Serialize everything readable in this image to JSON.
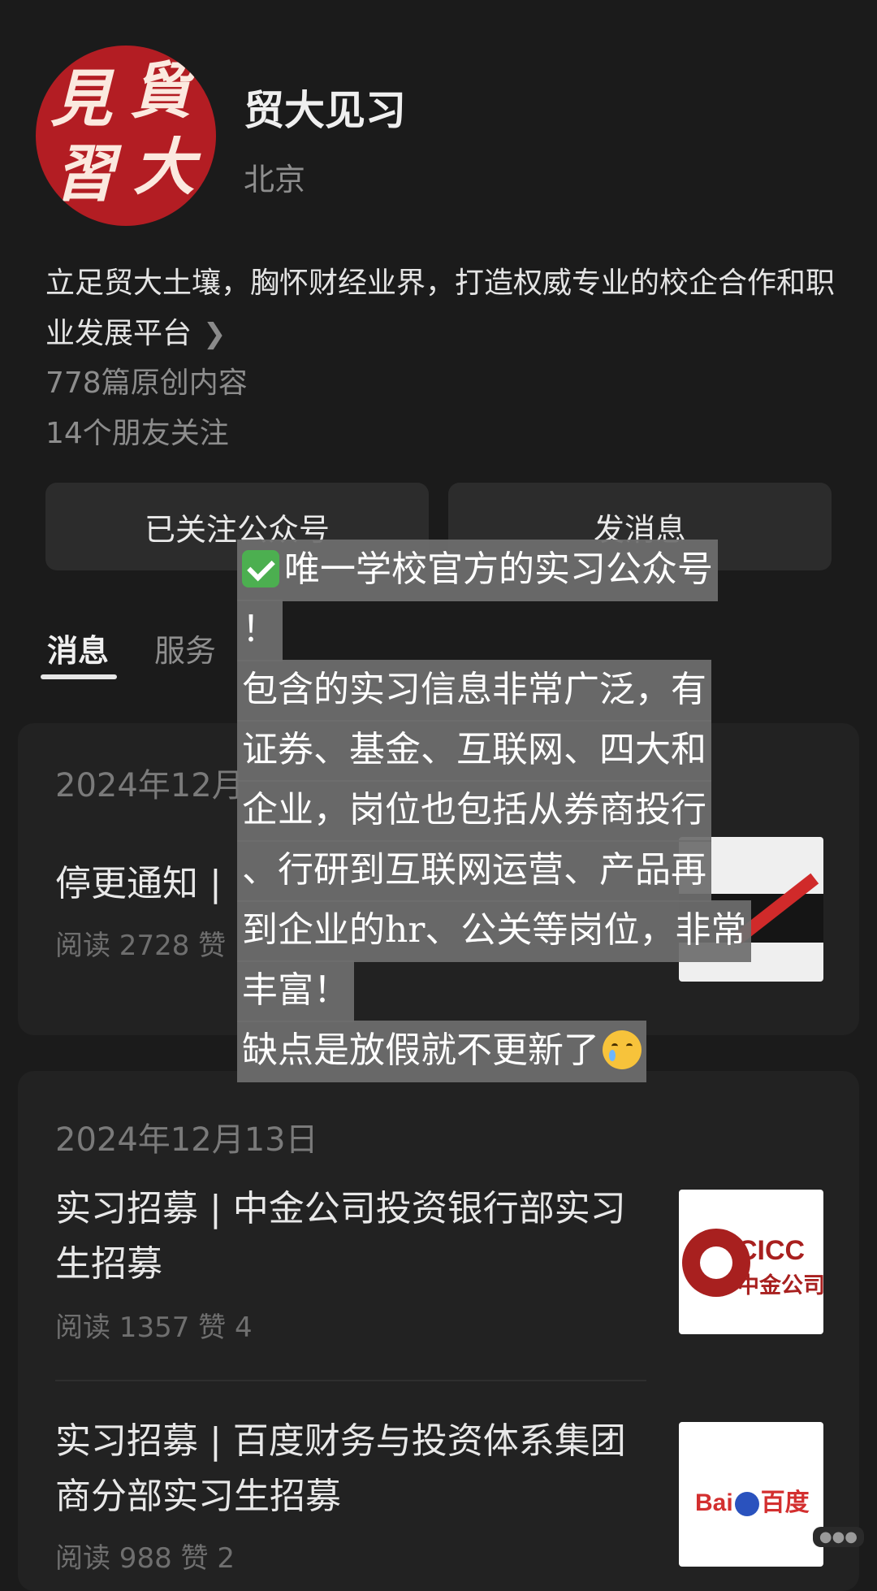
{
  "account": {
    "name": "贸大见习",
    "city": "北京",
    "description": "立足贸大土壤，胸怀财经业界，打造权威专业的校企合作和职业发展平台",
    "original_count": "778篇原创内容",
    "friends_following": "14个朋友关注",
    "logo_chars": [
      "見",
      "貿",
      "習",
      "大"
    ]
  },
  "buttons": {
    "followed": "已关注公众号",
    "message": "发消息"
  },
  "tabs": {
    "messages": "消息",
    "services": "服务"
  },
  "feed": {
    "card1": {
      "date": "2024年12月",
      "title": "停更通知 | ",
      "meta": "阅读 2728  赞"
    },
    "card2": {
      "date": "2024年12月13日",
      "articles": [
        {
          "title": "实习招募 | 中金公司投资银行部实习生招募",
          "meta": "阅读 1357  赞 4",
          "thumb_text_1": "CICC",
          "thumb_text_2": "中金公司"
        },
        {
          "title": "实习招募 | 百度财务与投资体系集团商分部实习生招募",
          "meta": "阅读 988  赞 2",
          "thumb_text_1": "Bai",
          "thumb_text_2": "百度"
        }
      ]
    }
  },
  "overlay": {
    "lines": [
      "唯一学校官方的实习公众号",
      "！",
      "包含的实习信息非常广泛，有",
      "证券、基金、互联网、四大和",
      "企业，岗位也包括从券商投行",
      "、行研到互联网运营、产品再",
      "到企业的hr、公关等岗位，非常",
      "丰富！",
      "缺点是放假就不更新了"
    ]
  },
  "colors": {
    "background": "#1b1b1b",
    "logo_red": "#b31d23",
    "card": "#222222"
  }
}
